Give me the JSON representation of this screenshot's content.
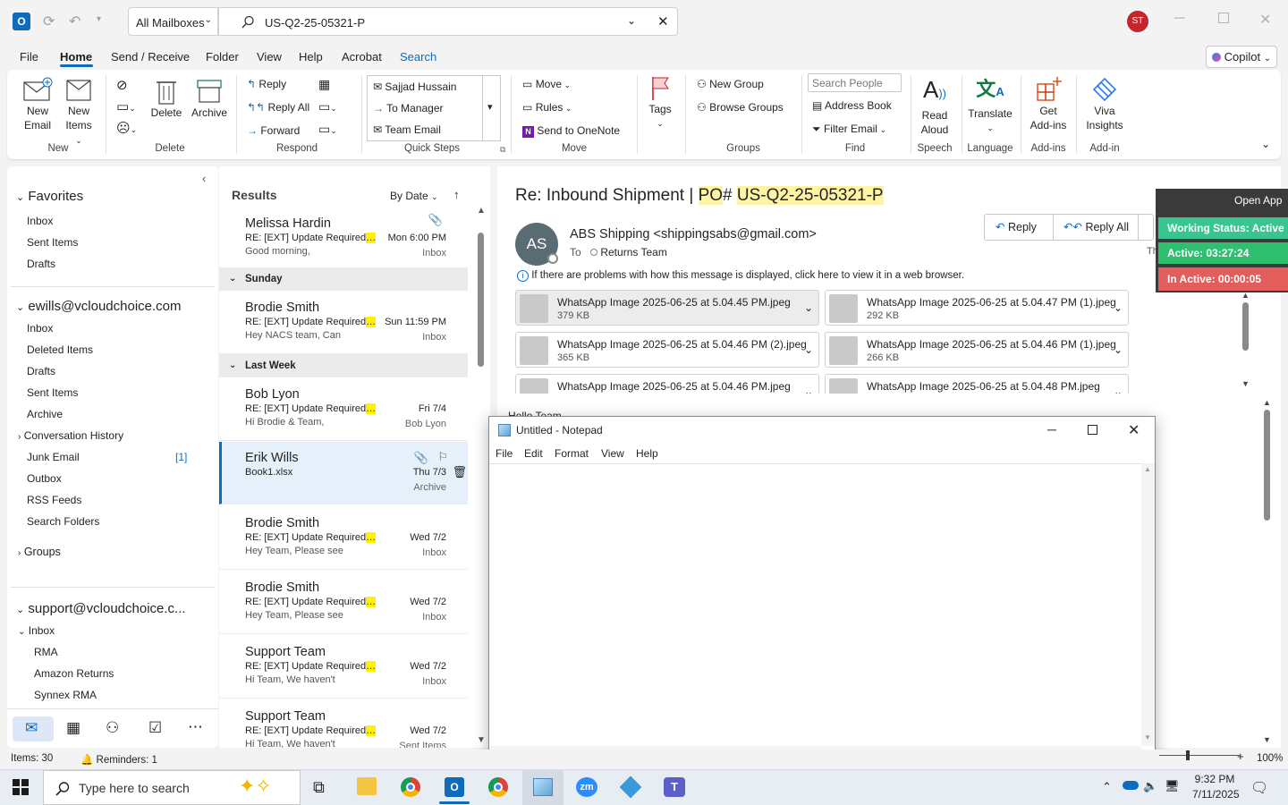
{
  "titlebar": {
    "mailbox_select": "All Mailboxes",
    "search_value": "US-Q2-25-05321-P",
    "user_initials": "ST"
  },
  "menu": {
    "file": "File",
    "home": "Home",
    "send_receive": "Send / Receive",
    "folder": "Folder",
    "view": "View",
    "help": "Help",
    "acrobat": "Acrobat",
    "search": "Search",
    "copilot": "Copilot"
  },
  "ribbon": {
    "new_email": [
      "New",
      "Email"
    ],
    "new_items": [
      "New",
      "Items"
    ],
    "group_new": "New",
    "delete": "Delete",
    "archive": "Archive",
    "group_delete": "Delete",
    "reply": "Reply",
    "reply_all": "Reply All",
    "forward": "Forward",
    "group_respond": "Respond",
    "qs_1": "Sajjad Hussain",
    "qs_2": "To Manager",
    "qs_3": "Team Email",
    "group_quicksteps": "Quick Steps",
    "move": "Move",
    "rules": "Rules",
    "onenote": "Send to OneNote",
    "group_move": "Move",
    "tags": "Tags",
    "new_group": "New Group",
    "browse_groups": "Browse Groups",
    "group_groups": "Groups",
    "search_people": "Search People",
    "address_book": "Address Book",
    "filter_email": "Filter Email",
    "group_find": "Find",
    "read_aloud": [
      "Read",
      "Aloud"
    ],
    "group_speech": "Speech",
    "translate": "Translate",
    "group_language": "Language",
    "get_addins": [
      "Get",
      "Add-ins"
    ],
    "group_addins": "Add-ins",
    "viva": [
      "Viva",
      "Insights"
    ],
    "group_addin": "Add-in"
  },
  "folders": {
    "favorites": "Favorites",
    "fav_items": [
      "Inbox",
      "Sent Items",
      "Drafts"
    ],
    "account1": "ewills@vcloudchoice.com",
    "acc1_items": [
      "Inbox",
      "Deleted Items",
      "Drafts",
      "Sent Items",
      "Archive",
      "Conversation History",
      "Junk Email",
      "Outbox",
      "RSS Feeds",
      "Search Folders"
    ],
    "junk_count": "[1]",
    "groups": "Groups",
    "account2": "support@vcloudchoice.c...",
    "acc2_inbox": "Inbox",
    "acc2_items": [
      "RMA",
      "Amazon Returns",
      "Synnex RMA"
    ]
  },
  "list": {
    "header": "Results",
    "sort": "By Date",
    "sections": [
      "Sunday",
      "Last Week"
    ],
    "messages": [
      {
        "from": "Melissa Hardin",
        "subject": "RE: [EXT] Update Required",
        "preview": "Good morning,",
        "date": "Mon 6:00 PM",
        "folder": "Inbox"
      },
      {
        "from": "Brodie Smith",
        "subject": "RE: [EXT] Update Required",
        "preview": "Hey NACS team,  Can",
        "date": "Sun 11:59 PM",
        "folder": "Inbox"
      },
      {
        "from": "Bob Lyon",
        "subject": "RE: [EXT] Update Required",
        "preview": "Hi Brodie & Team,",
        "date": "Fri 7/4",
        "folder": "Bob Lyon"
      },
      {
        "from": "Erik Wills",
        "subject": "Book1.xlsx",
        "preview": "",
        "date": "Thu 7/3",
        "folder": "Archive"
      },
      {
        "from": "Brodie Smith",
        "subject": "RE: [EXT] Update Required",
        "preview": "Hey Team,  Please see",
        "date": "Wed 7/2",
        "folder": "Inbox"
      },
      {
        "from": "Brodie Smith",
        "subject": "RE: [EXT] Update Required",
        "preview": "Hey Team,  Please see",
        "date": "Wed 7/2",
        "folder": "Inbox"
      },
      {
        "from": "Support Team",
        "subject": "RE: [EXT] Update Required",
        "preview": "Hi Team,  We haven't",
        "date": "Wed 7/2",
        "folder": "Inbox"
      },
      {
        "from": "Support Team",
        "subject": "RE: [EXT] Update Required",
        "preview": "Hi Team,  We haven't",
        "date": "Wed 7/2",
        "folder": "Sent Items"
      }
    ]
  },
  "reading": {
    "subject_pre": "Re: Inbound Shipment | ",
    "subject_po": "PO",
    "subject_mid": "# ",
    "subject_num": "US-Q2-25-05321-P",
    "avatar": "AS",
    "sender": "ABS Shipping <shippingsabs@gmail.com>",
    "to_label": "To",
    "to": "Returns Team",
    "info": "If there are problems with how this message is displayed, click here to view it in a web browser.",
    "reply": "Reply",
    "reply_all": "Reply All",
    "date_partial": "Th",
    "body_partial": "Hello Team",
    "attachments": [
      {
        "name": "WhatsApp Image 2025-06-25 at 5.04.45 PM.jpeg",
        "size": "379 KB"
      },
      {
        "name": "WhatsApp Image 2025-06-25 at 5.04.47 PM (1).jpeg",
        "size": "292 KB"
      },
      {
        "name": "WhatsApp Image 2025-06-25 at 5.04.46 PM (2).jpeg",
        "size": "365 KB"
      },
      {
        "name": "WhatsApp Image 2025-06-25 at 5.04.46 PM (1).jpeg",
        "size": "266 KB"
      },
      {
        "name": "WhatsApp Image 2025-06-25 at 5.04.46 PM.jpeg",
        "size": ""
      },
      {
        "name": "WhatsApp Image 2025-06-25 at 5.04.48 PM.jpeg",
        "size": ""
      }
    ]
  },
  "overlay": {
    "open_app": "Open App",
    "status": "Working Status: Active",
    "active": "Active: 03:27:24",
    "inactive": "In Active: 00:00:05",
    "colors": {
      "status": "#39c68e",
      "active": "#2fbf71",
      "inactive": "#e35d5d"
    }
  },
  "notepad": {
    "title": "Untitled - Notepad",
    "menu": [
      "File",
      "Edit",
      "Format",
      "View",
      "Help"
    ]
  },
  "statusbar": {
    "items": "Items: 30",
    "reminders": "Reminders: 1",
    "zoom": "100%"
  },
  "taskbar": {
    "search_placeholder": "Type here to search",
    "time": "9:32 PM",
    "date": "7/11/2025"
  }
}
